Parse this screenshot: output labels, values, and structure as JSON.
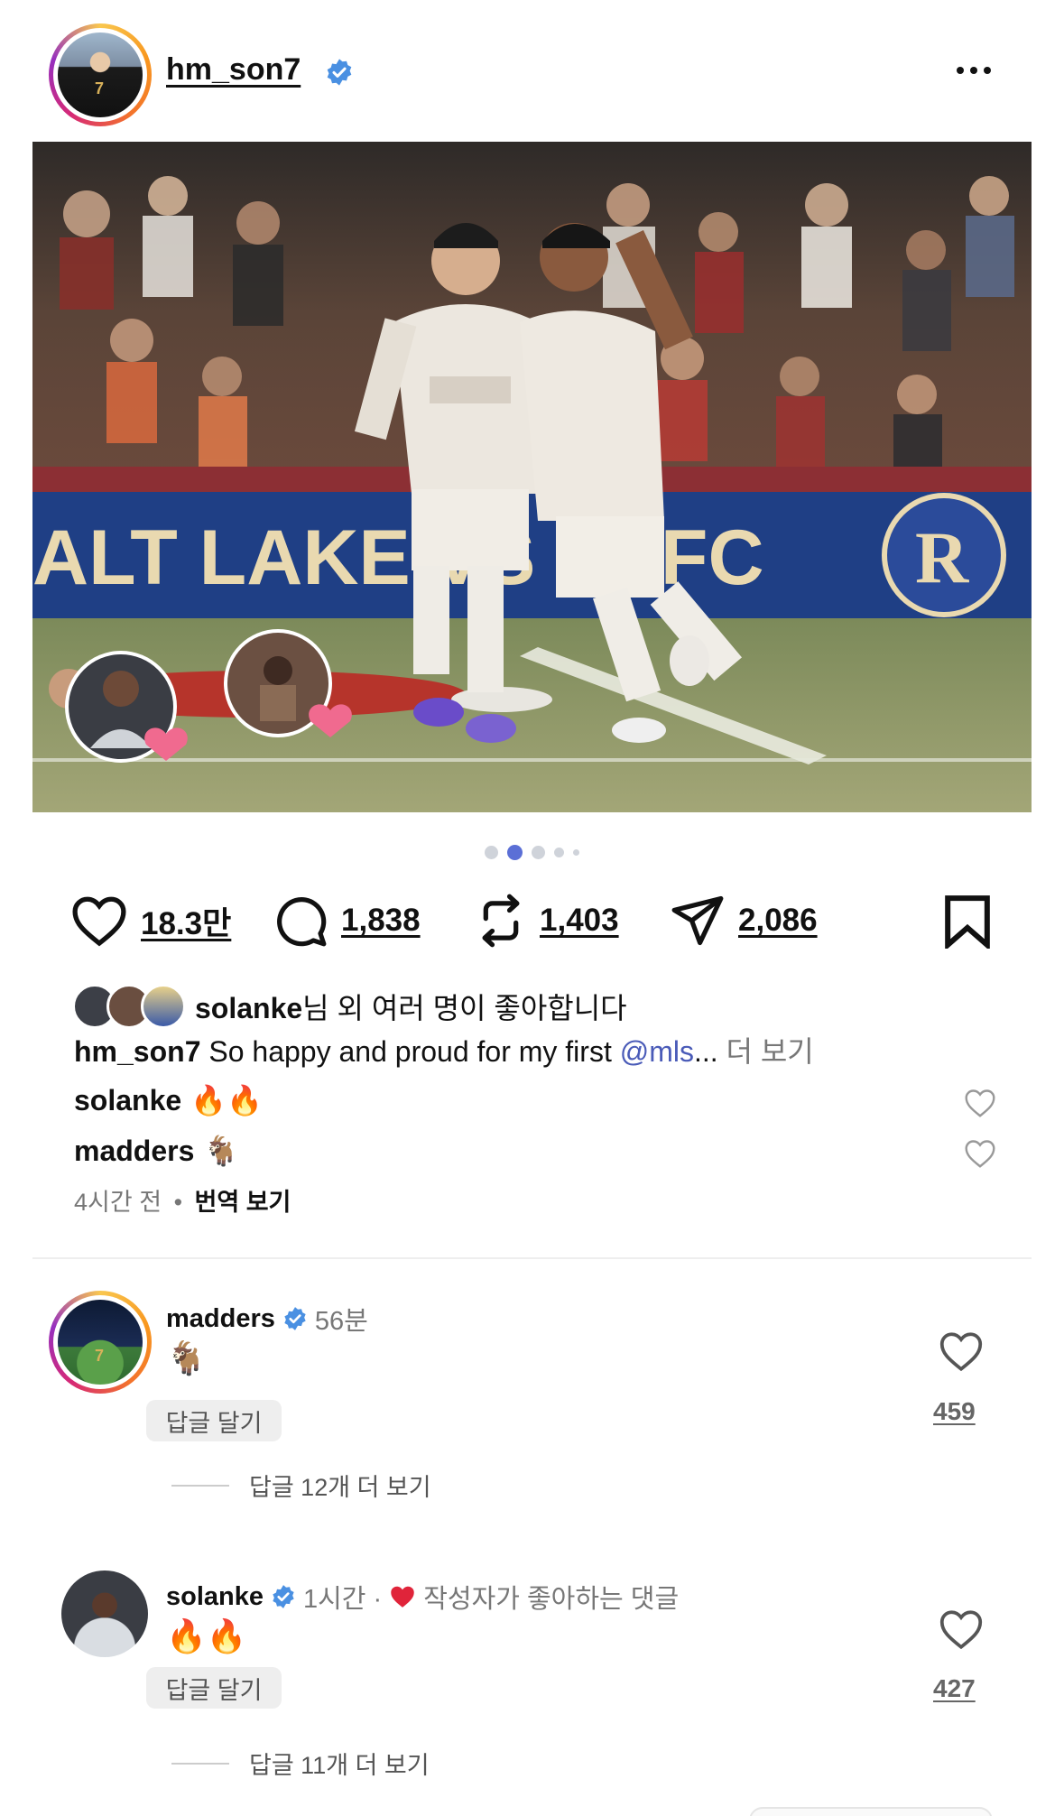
{
  "header": {
    "username": "hm_son7",
    "verified": true,
    "more_icon": "ellipsis-icon"
  },
  "photo": {
    "description_icon": "photo",
    "ad_board_text": "ALT LAKE VS LAFC",
    "carousel_total": 5,
    "carousel_active_index": 1
  },
  "actions": {
    "likes": "18.3만",
    "comments": "1,838",
    "reposts": "1,403",
    "shares": "2,086"
  },
  "caption": {
    "liked_by_user": "solanke",
    "liked_by_suffix": "님 외 여러 명이 좋아합니다",
    "author": "hm_son7",
    "text_before": " So happy and proud for my first ",
    "mention": "@mls",
    "ellipsis": "...",
    "more_label": " 더 보기"
  },
  "inline_comments": [
    {
      "user": "solanke",
      "text": "🔥🔥"
    },
    {
      "user": "madders",
      "text": "🐐"
    }
  ],
  "meta": {
    "time_ago": "4시간 전",
    "separator": "•",
    "translate_label": "번역 보기"
  },
  "comments": [
    {
      "user": "madders",
      "verified": true,
      "time": "56분",
      "text": "🐐",
      "reply_label": "답글 달기",
      "like_count": "459",
      "view_replies": "답글 12개 더 보기"
    },
    {
      "user": "solanke",
      "verified": true,
      "time": "1시간 ·",
      "author_liked_label": "작성자가 좋아하는 댓글",
      "text": "🔥🔥",
      "reply_label": "답글 달기",
      "like_count": "427",
      "view_replies": "답글 11개 더 보기"
    }
  ],
  "colors": {
    "verified_blue": "#4a90e2",
    "mention_blue": "#4a5bb8",
    "carousel_active": "#5b6fd6",
    "heart_red": "#e0243a"
  }
}
